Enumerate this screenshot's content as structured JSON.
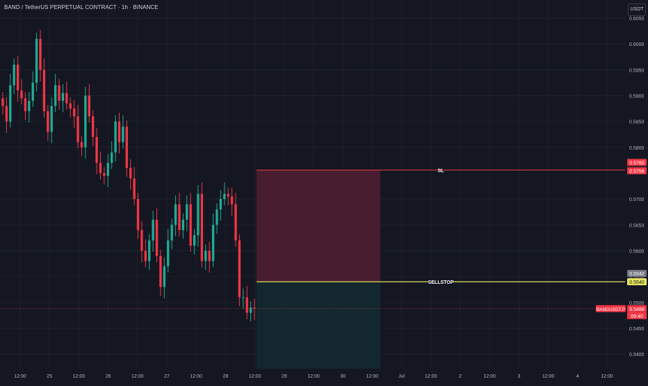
{
  "header": {
    "title": "BAND / TetherUS PERPETUAL CONTRACT · 1h · BINANCE",
    "currency": "USDT"
  },
  "colors": {
    "background": "#141722",
    "grid": "#1e222d",
    "up": "#22ab94",
    "down": "#f23645",
    "text": "#b2b5be",
    "sl": "#f23645",
    "sellstop": "#e6e65c",
    "risk_zone": "#4a1e30",
    "reward_zone": "#13282f"
  },
  "chart_data": {
    "type": "candlestick",
    "ylim": [
      0.5372,
      0.6085
    ],
    "y_ticks": [
      "0.6050",
      "0.6000",
      "0.5950",
      "0.5900",
      "0.5850",
      "0.5800",
      "0.5700",
      "0.5650",
      "0.5600",
      "0.5550",
      "0.5500",
      "0.5450",
      "0.5400"
    ],
    "x_ticks": [
      "12:00",
      "25",
      "12:00",
      "26",
      "12:00",
      "27",
      "12:00",
      "28",
      "12:00",
      "29",
      "12:00",
      "30",
      "12:00",
      "Jul",
      "12:00",
      "2",
      "12:00",
      "3",
      "12:00",
      "4",
      "12:00"
    ],
    "closes": [
      0.588,
      0.585,
      0.592,
      0.596,
      0.591,
      0.5895,
      0.587,
      0.589,
      0.5925,
      0.601,
      0.595,
      0.587,
      0.583,
      0.588,
      0.592,
      0.589,
      0.5905,
      0.5885,
      0.5875,
      0.586,
      0.581,
      0.58,
      0.59,
      0.586,
      0.582,
      0.577,
      0.575,
      0.5745,
      0.577,
      0.579,
      0.585,
      0.581,
      0.584,
      0.576,
      0.574,
      0.57,
      0.564,
      0.56,
      0.558,
      0.562,
      0.566,
      0.559,
      0.553,
      0.557,
      0.562,
      0.565,
      0.569,
      0.564,
      0.566,
      0.569,
      0.561,
      0.563,
      0.571,
      0.558,
      0.56,
      0.558,
      0.565,
      0.568,
      0.57,
      0.571,
      0.5705,
      0.569,
      0.562,
      0.551,
      0.551,
      0.548,
      0.549,
      0.5488
    ],
    "annotations": {
      "sl_label": "SL",
      "sl_price": 0.5756,
      "sl_tag": "0.5756",
      "sl_top_tag": "0.5760",
      "sellstop_label": "SELLSTOP",
      "sellstop_price": 0.554,
      "sellstop_tag": "0.5540",
      "entry_tag": "0.5542",
      "last_price": 0.5488,
      "last_price_tag": "0.5488",
      "symbol_tag": "BANDUSDT.P",
      "countdown": "09:40"
    }
  }
}
